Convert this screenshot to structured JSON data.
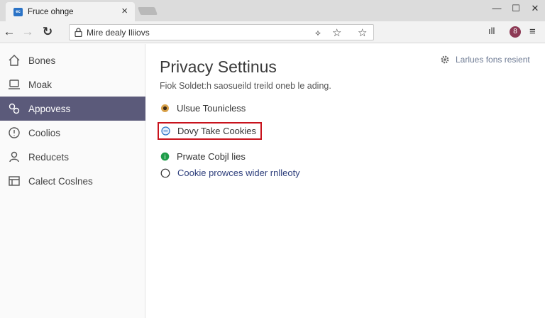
{
  "tab": {
    "title": "Fruce ohnge",
    "favicon_text": "ec"
  },
  "window_controls": {
    "minimize": "—",
    "maximize": "☐",
    "close": "✕"
  },
  "toolbar": {
    "back": "←",
    "forward": "→",
    "reload": "↻",
    "address": "Mire dealy Iliiovs",
    "profile_initial": "8",
    "menu": "≡"
  },
  "sidebar": {
    "items": [
      {
        "label": "Bones",
        "icon": "home-icon"
      },
      {
        "label": "Moak",
        "icon": "laptop-icon"
      },
      {
        "label": "Appovess",
        "icon": "puzzle-icon",
        "active": true
      },
      {
        "label": "Coolios",
        "icon": "info-icon"
      },
      {
        "label": "Reducets",
        "icon": "person-icon"
      },
      {
        "label": "Calect Coslnes",
        "icon": "window-icon"
      }
    ]
  },
  "main": {
    "title": "Privacy Settinus",
    "description": "Fiok Soldet:h saosueild treild oneb le ading.",
    "top_link": "Larlues fons resient",
    "options": [
      {
        "label": "Ulsue Tounicless",
        "icon": "eye-icon"
      },
      {
        "label": "Dovy Take Cookies",
        "icon": "cookie-icon",
        "highlighted": true
      },
      {
        "label": "Prwate Cobjl lies",
        "icon": "shield-check-icon"
      },
      {
        "label": "Cookie prowces wider rnlleoty",
        "icon": "radio-icon"
      }
    ]
  },
  "colors": {
    "active_sidebar": "#5b5a7a",
    "highlight_border": "#c8131d",
    "link": "#2e3f7c",
    "green": "#1f9d4a"
  }
}
